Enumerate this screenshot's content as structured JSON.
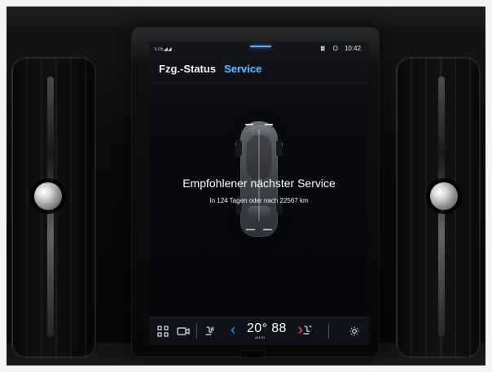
{
  "screen": {
    "status_bar": {
      "signal_text": "LTE◢◢",
      "right_icon": "bluetooth-icon",
      "right_badge": "O",
      "time": "10:42"
    },
    "tabs": {
      "left": "Fzg.-Status",
      "right": "Service"
    },
    "service": {
      "headline": "Empfohlener nächster Service",
      "subline": "In 124 Tagen oder nach 22567 km"
    },
    "toolbar": {
      "temperature": "20° 88",
      "auto": "AUTO"
    }
  },
  "colors": {
    "accent_blue": "#57b9ff",
    "temp_left_arrow": "#2f98ff",
    "temp_right_arrow": "#ff4e47"
  },
  "icons": [
    "grid-icon",
    "camera-icon",
    "seat-heat-icon",
    "chevron-left-icon",
    "chevron-right-icon",
    "seat-right-icon",
    "settings-icon",
    "car-top-view-icon"
  ]
}
